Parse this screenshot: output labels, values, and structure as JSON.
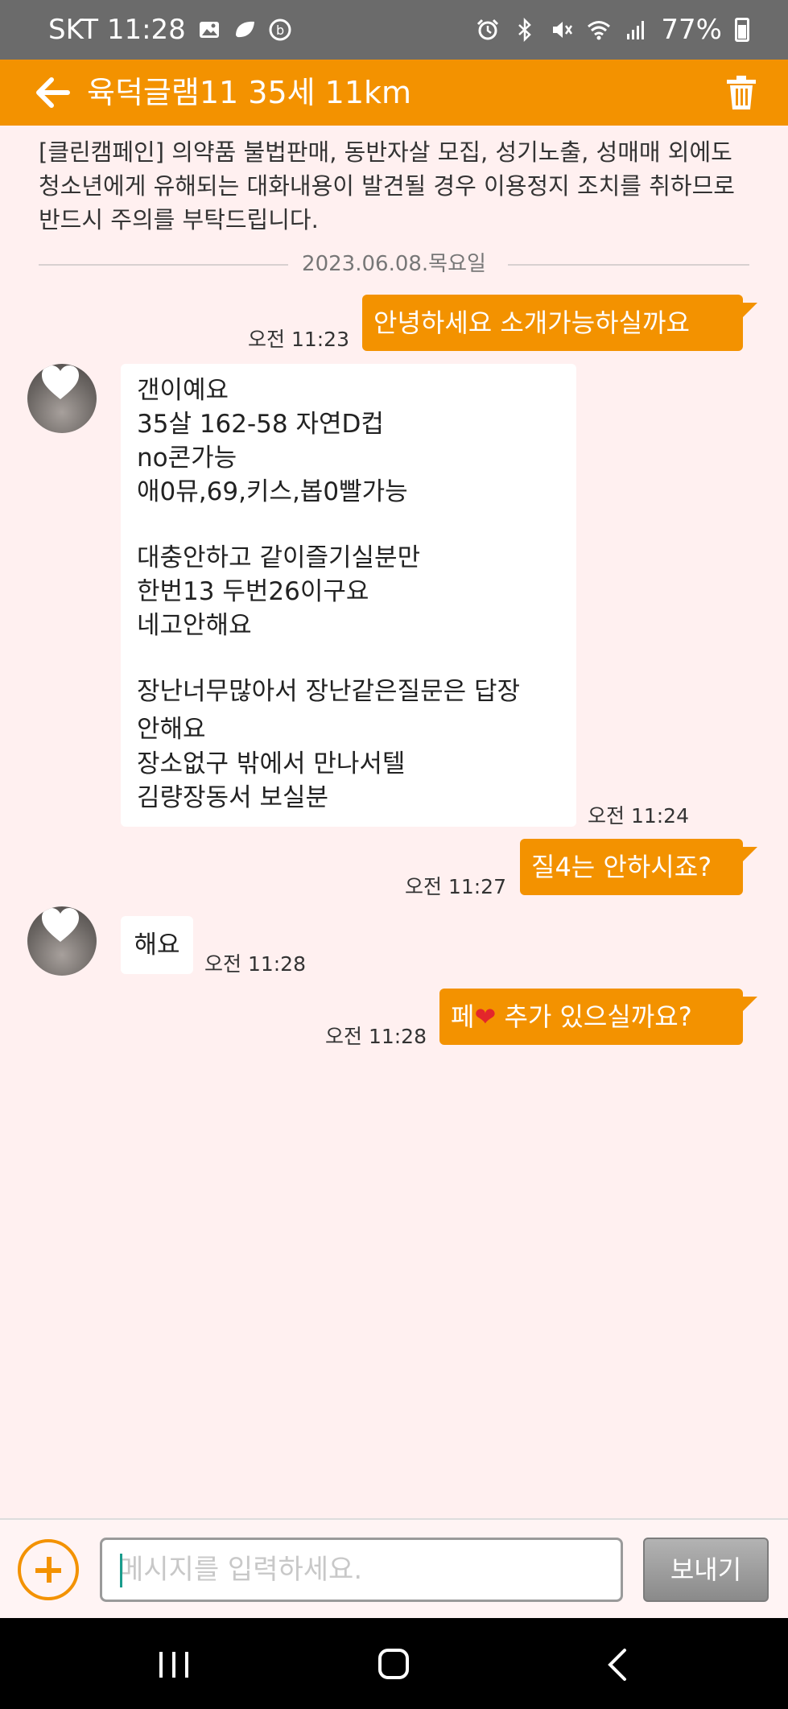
{
  "status_bar": {
    "carrier_time": "SKT 11:28",
    "battery": "77%"
  },
  "header": {
    "title": "육덕글램11 35세 11km"
  },
  "notice": "[클린캠페인] 의약품 불법판매, 동반자살 모집, 성기노출, 성매매 외에도 청소년에게 유해되는 대화내용이 발견될 경우 이용정지 조치를 취하므로 반드시 주의를 부탁드립니다.",
  "date_divider": "2023.06.08.목요일",
  "messages": [
    {
      "text": "안녕하세요 소개가능하실까요",
      "time": "오전 11:23"
    },
    {
      "lines": [
        "갠이예요",
        "35살 162-58 자연D컵",
        "no콘가능",
        "애0뮤,69,키스,봅0빨가능",
        "",
        "대충안하고 같이즐기실분만",
        "한번13 두번26이구요",
        "네고안해요",
        "",
        "장난너무많아서 장난같은질문은 답장",
        "안해요",
        "장소없구 밖에서 만나서텔",
        "김량장동서 보실분"
      ],
      "time": "오전 11:24"
    },
    {
      "text": "질4는 안하시죠?",
      "time": "오전 11:27"
    },
    {
      "text": "해요",
      "time": "오전 11:28"
    },
    {
      "text_before": "페",
      "heart": "❤",
      "text_after": " 추가 있으실까요?",
      "time": "오전 11:28"
    }
  ],
  "input": {
    "placeholder": "메시지를 입력하세요."
  },
  "send_label": "보내기",
  "colors": {
    "accent": "#f39200",
    "background": "#fff0f0",
    "statusbar": "#6b6b6b"
  }
}
